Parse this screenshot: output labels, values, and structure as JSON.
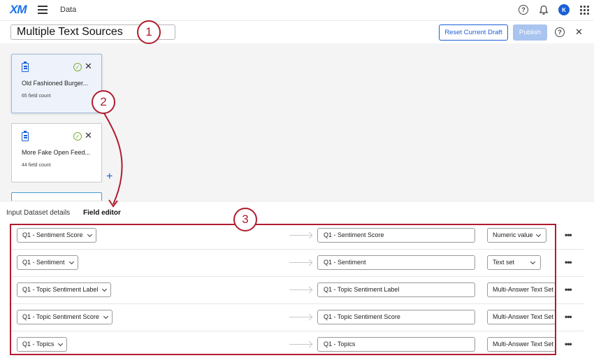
{
  "header": {
    "logo": "XM",
    "app_name": "Data",
    "avatar_initial": "K"
  },
  "title_bar": {
    "title_value": "Multiple Text Sources",
    "reset_label": "Reset Current Draft",
    "publish_label": "Publish"
  },
  "sources": [
    {
      "title": "Old Fashioned Burger...",
      "count": "65 field count"
    },
    {
      "title": "More Fake Open Feed...",
      "count": "44 field count"
    }
  ],
  "add_symbol": "+",
  "tabs": [
    {
      "label": "Input Dataset details",
      "active": false
    },
    {
      "label": "Field editor",
      "active": true
    }
  ],
  "fields": [
    {
      "source": "Q1 - Sentiment Score",
      "target": "Q1 - Sentiment Score",
      "type": "Numeric value"
    },
    {
      "source": "Q1 - Sentiment",
      "target": "Q1 - Sentiment",
      "type": "Text set"
    },
    {
      "source": "Q1 - Topic Sentiment Label",
      "target": "Q1 - Topic Sentiment Label",
      "type": "Multi-Answer Text Set"
    },
    {
      "source": "Q1 - Topic Sentiment Score",
      "target": "Q1 - Topic Sentiment Score",
      "type": "Multi-Answer Text Set"
    },
    {
      "source": "Q1 - Topics",
      "target": "Q1 - Topics",
      "type": "Multi-Answer Text Set"
    }
  ],
  "callouts": [
    "1",
    "2",
    "3"
  ],
  "colors": {
    "accent": "#1a5fd8",
    "annotation": "#b01c2e",
    "success": "#7ab036"
  }
}
